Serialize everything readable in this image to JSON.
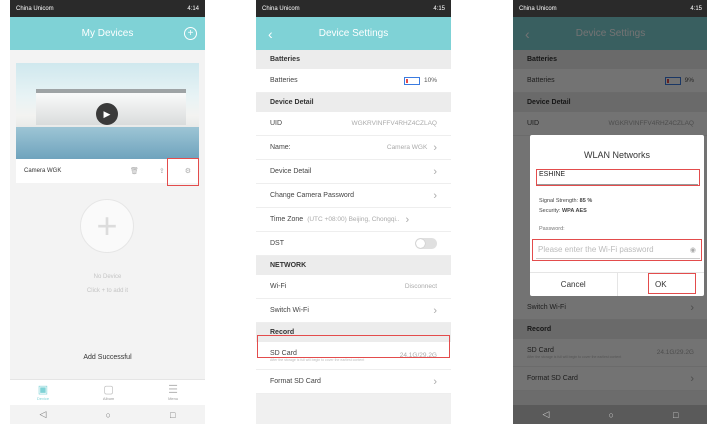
{
  "status_bar": {
    "p1": {
      "carrier": "China Unicom",
      "time": "4:14"
    },
    "p2": {
      "carrier": "China Unicom",
      "time": "4:15"
    },
    "p3": {
      "carrier": "China Unicom",
      "time": "4:15"
    }
  },
  "my_devices": {
    "title": "My Devices",
    "camera_name": "Camera WGK",
    "no_device": "No Device",
    "click_to_add": "Click + to add it",
    "add_successful": "Add Successful",
    "tabs": [
      {
        "label": "Device",
        "icon": "device-icon"
      },
      {
        "label": "Album",
        "icon": "album-icon"
      },
      {
        "label": "Menu",
        "icon": "menu-icon"
      }
    ]
  },
  "device_settings": {
    "title": "Device Settings",
    "sections": {
      "batteries": "Batteries",
      "device_detail": "Device Detail",
      "network": "NETWORK",
      "record": "Record"
    },
    "rows": {
      "batteries": {
        "label": "Batteries",
        "value": "10%"
      },
      "uid": {
        "label": "UID",
        "value": "WGKRVINFFV4RHZ4CZLAQ"
      },
      "name": {
        "label": "Name:",
        "value": "Camera WGK"
      },
      "device_detail": {
        "label": "Device Detail"
      },
      "change_password": {
        "label": "Change Camera Password"
      },
      "time_zone": {
        "label": "Time Zone",
        "value": "(UTC +08:00) Beijing, Chongqi.."
      },
      "dst": {
        "label": "DST"
      },
      "wifi": {
        "label": "Wi-Fi",
        "value": "Disconnect"
      },
      "switch_wifi": {
        "label": "Switch Wi-Fi"
      },
      "sd_card": {
        "label": "SD Card",
        "value": "24.1G/29.2G",
        "sub": "After the storage is full will begin to cover the earliest content"
      },
      "format_sd": {
        "label": "Format SD Card"
      }
    }
  },
  "wlan_dialog": {
    "title": "WLAN Networks",
    "ssid": "ESHINE",
    "signal_label": "Signal Strength:",
    "signal_value": "85 %",
    "security_label": "Security:",
    "security_value": "WPA AES",
    "password_label": "Password:",
    "password_placeholder": "Please enter the Wi-Fi password",
    "cancel": "Cancel",
    "ok": "OK"
  },
  "background_p3": {
    "title": "Device Settings",
    "batteries_section": "Batteries",
    "batteries": "Batteries",
    "battery_value": "9%",
    "device_detail_section": "Device Detail",
    "uid": "UID",
    "uid_value": "WGKRVINFFV4RHZ4CZLAQ",
    "switch_wifi": "Switch Wi-Fi",
    "record": "Record",
    "sd_card": "SD Card",
    "sd_value": "24.1G/29.2G",
    "sd_sub": "After the storage is full will begin to cover the earliest content",
    "format_sd": "Format SD Card"
  },
  "colors": {
    "accent": "#7fd2d6",
    "highlight": "#e34c4c"
  }
}
